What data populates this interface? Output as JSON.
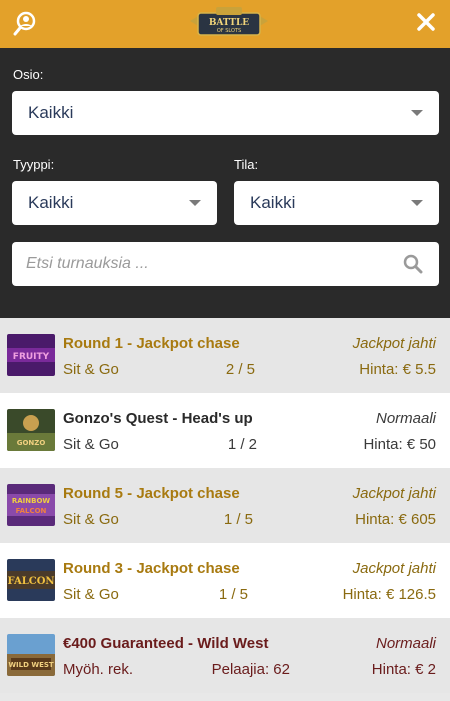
{
  "header": {
    "logo_text": "BATTLE OF SLOTS",
    "user_icon": "user-search-icon",
    "close_icon": "close-icon",
    "brand_color": "#e3a12a"
  },
  "filters": {
    "section_label": "Osio:",
    "section_value": "Kaikki",
    "type_label": "Tyyppi:",
    "type_value": "Kaikki",
    "state_label": "Tila:",
    "state_value": "Kaikki",
    "search_placeholder": "Etsi turnauksia ..."
  },
  "tournaments": [
    {
      "title": "Round 1 - Jackpot chase",
      "kind": "Sit & Go",
      "count": "2 / 5",
      "status": "Jackpot jahti",
      "price": "Hinta: € 5.5"
    },
    {
      "title": "Gonzo's Quest - Head's up",
      "kind": "Sit & Go",
      "count": "1 / 2",
      "status": "Normaali",
      "price": "Hinta: € 50"
    },
    {
      "title": "Round 5 - Jackpot chase",
      "kind": "Sit & Go",
      "count": "1 / 5",
      "status": "Jackpot jahti",
      "price": "Hinta: € 605"
    },
    {
      "title": "Round 3 - Jackpot chase",
      "kind": "Sit & Go",
      "count": "1 / 5",
      "status": "Jackpot jahti",
      "price": "Hinta: € 126.5"
    },
    {
      "title": "€400 Guaranteed - Wild West",
      "kind": "Myöh. rek.",
      "count": "Pelaajia: 62",
      "status": "Normaali",
      "price": "Hinta: € 2"
    }
  ]
}
